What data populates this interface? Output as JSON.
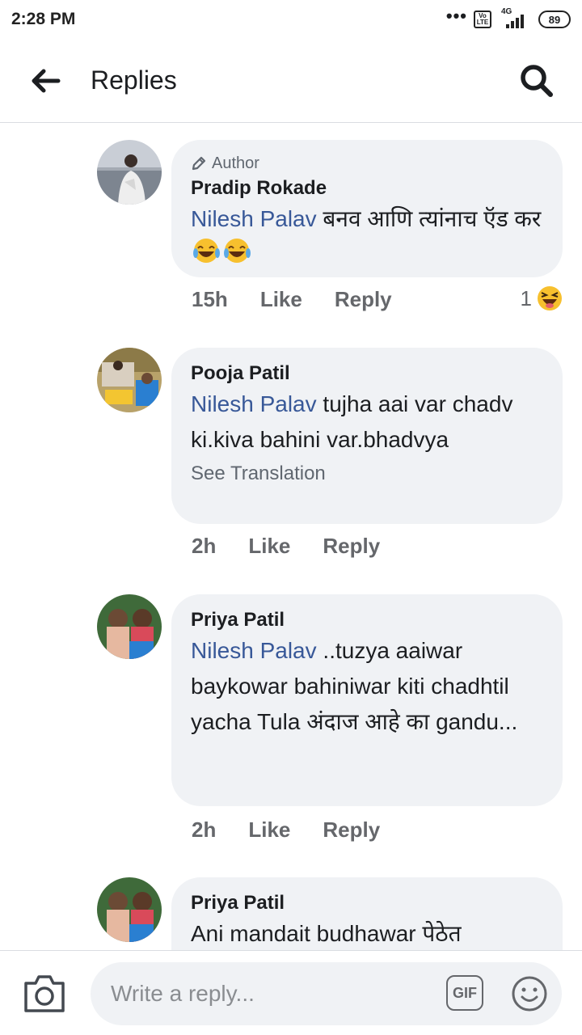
{
  "status_bar": {
    "time": "2:28 PM",
    "dots": "•••",
    "volte_top": "Vo",
    "volte_bottom": "LTE",
    "network": "4G",
    "battery": "89"
  },
  "header": {
    "title": "Replies",
    "back_icon": "arrow-left-icon",
    "search_icon": "search-icon"
  },
  "comments": [
    {
      "author_badge": "Author",
      "name": "Pradip Rokade",
      "mention": "Nilesh Palav",
      "text": " बनव आणि त्यांनाच ऍड कर ",
      "time": "15h",
      "like": "Like",
      "reply": "Reply",
      "reaction_count": "1"
    },
    {
      "name": "Pooja Patil",
      "mention": "Nilesh Palav",
      "text": " tujha aai var chadv ki.kiva bahini var.bhadvya",
      "see_translation": "See Translation",
      "time": "2h",
      "like": "Like",
      "reply": "Reply"
    },
    {
      "name": "Priya Patil",
      "mention": "Nilesh Palav",
      "text": " ..tuzya aaiwar baykowar bahiniwar kiti chadhtil yacha Tula अंदाज आहे का gandu...",
      "time": "2h",
      "like": "Like",
      "reply": "Reply"
    },
    {
      "name": "Priya Patil",
      "text": "Ani mandait budhawar पेठेत"
    }
  ],
  "reply_bar": {
    "placeholder": "Write a reply...",
    "gif_label": "GIF",
    "camera_icon": "camera-icon",
    "emoji_icon": "smiley-icon"
  },
  "colors": {
    "mention": "#385898",
    "bubble": "#f0f2f5",
    "meta": "#65676b"
  }
}
